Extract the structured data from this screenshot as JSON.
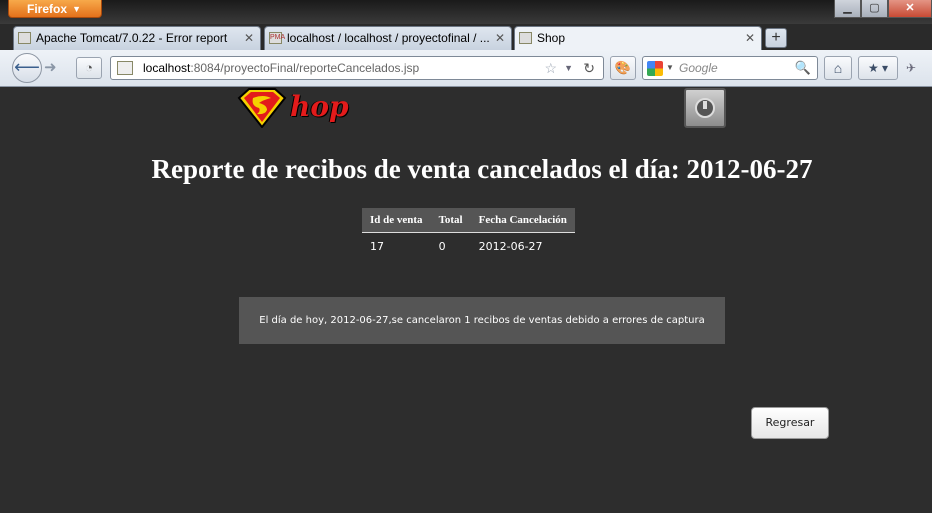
{
  "browser": {
    "menu_label": "Firefox",
    "tabs": [
      {
        "title": "Apache Tomcat/7.0.22 - Error report",
        "favicon": "page-icon"
      },
      {
        "title": "localhost / localhost / proyectofinal / ...",
        "favicon": "pma-icon",
        "favicon_text": "PMA"
      },
      {
        "title": "Shop",
        "favicon": "page-icon"
      }
    ],
    "url_host": "localhost",
    "url_path": ":8084/proyectoFinal/reporteCancelados.jsp",
    "search_placeholder": "Google",
    "window_controls": [
      "minimize",
      "maximize",
      "close"
    ]
  },
  "page": {
    "logo_text": "hop",
    "title": "Reporte de recibos de venta cancelados el día: 2012-06-27",
    "table": {
      "headers": [
        "Id de venta",
        "Total",
        "Fecha Cancelación"
      ],
      "rows": [
        [
          "17",
          "0",
          "2012-06-27"
        ]
      ]
    },
    "summary": "El día de hoy, 2012-06-27,se cancelaron 1 recibos de ventas debido a errores de captura",
    "back_label": "Regresar"
  },
  "colors": {
    "page_bg": "#2d2d2d",
    "box_bg": "#555555",
    "logo_red": "#e31b1b"
  }
}
